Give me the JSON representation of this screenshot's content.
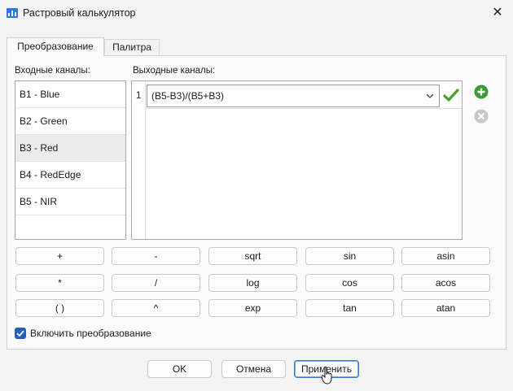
{
  "window": {
    "title": "Растровый калькулятор",
    "icon": "raster-chart-icon",
    "close_glyph": "✕"
  },
  "tabs": [
    {
      "label": "Преобразование",
      "active": true
    },
    {
      "label": "Палитра",
      "active": false
    }
  ],
  "input": {
    "label": "Входные каналы:",
    "channels": [
      "B1 - Blue",
      "B2 - Green",
      "B3 - Red",
      "B4 - RedEdge",
      "B5 - NIR"
    ],
    "selected": "B3 - Red"
  },
  "output": {
    "label": "Выходные каналы:",
    "rows": [
      {
        "num": "1",
        "formula": "(B5-B3)/(B5+B3)"
      }
    ]
  },
  "operators": {
    "row1": [
      "+",
      "-",
      "sqrt",
      "sin",
      "asin"
    ],
    "row2": [
      "*",
      "/",
      "log",
      "cos",
      "acos"
    ],
    "row3": [
      "( )",
      "^",
      "exp",
      "tan",
      "atan"
    ]
  },
  "enable_transform": {
    "label": "Включить преобразование",
    "checked": true
  },
  "buttons": {
    "ok": "OK",
    "cancel": "Отмена",
    "apply": "Применить"
  },
  "colors": {
    "accent": "#1f5fbf",
    "add_green": "#3c9a35",
    "check_green": "#4a9e2f"
  }
}
